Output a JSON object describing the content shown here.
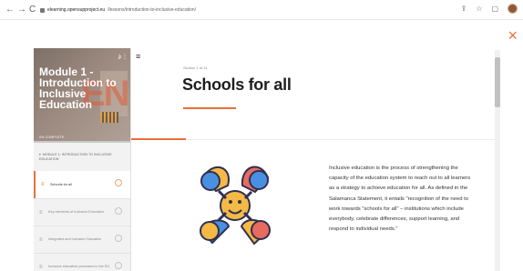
{
  "browser": {
    "back": "←",
    "forward": "→",
    "reload": "C",
    "url_domain": "elearning.opensupproject.eu",
    "url_path": "/lessons/introduction-to-inclusive-education/"
  },
  "course": {
    "title": "Module 1 - Introduction to Inclusive Education",
    "progress_label": "0% COMPLETE",
    "progress_percent": 0
  },
  "outline": {
    "module_label": "MODULE 1: INTRODUCTION TO INCLUSIVE EDUCATION",
    "lessons": [
      {
        "label": "Schools for all",
        "active": true
      },
      {
        "label": "Key elements of Inclusive Education",
        "active": false
      },
      {
        "label": "Integrated and Inclusive Education",
        "active": false
      },
      {
        "label": "Inclusive education panorama in the EU",
        "active": false
      }
    ]
  },
  "lesson": {
    "section_label": "Section 1 of 11",
    "title": "Schools for all",
    "body": "Inclusive education is the process of strengthening the capacity of the education system to reach out to all learners as a strategy to achieve education for all. As defined in the Salamanca Statement, it entails \"recognition of the need to work towards \"schools for all\" – institutions which include everybody, celebrate differences, support learning, and respond to individual needs.\""
  },
  "icons": {
    "close": "×",
    "menu": "≡",
    "search": "⌕",
    "share": "⇪",
    "star": "☆",
    "window": "▢"
  },
  "colors": {
    "accent": "#e8703a",
    "illustration_orange": "#f5b945",
    "illustration_blue": "#4a90e2",
    "illustration_red": "#e76b5f"
  }
}
